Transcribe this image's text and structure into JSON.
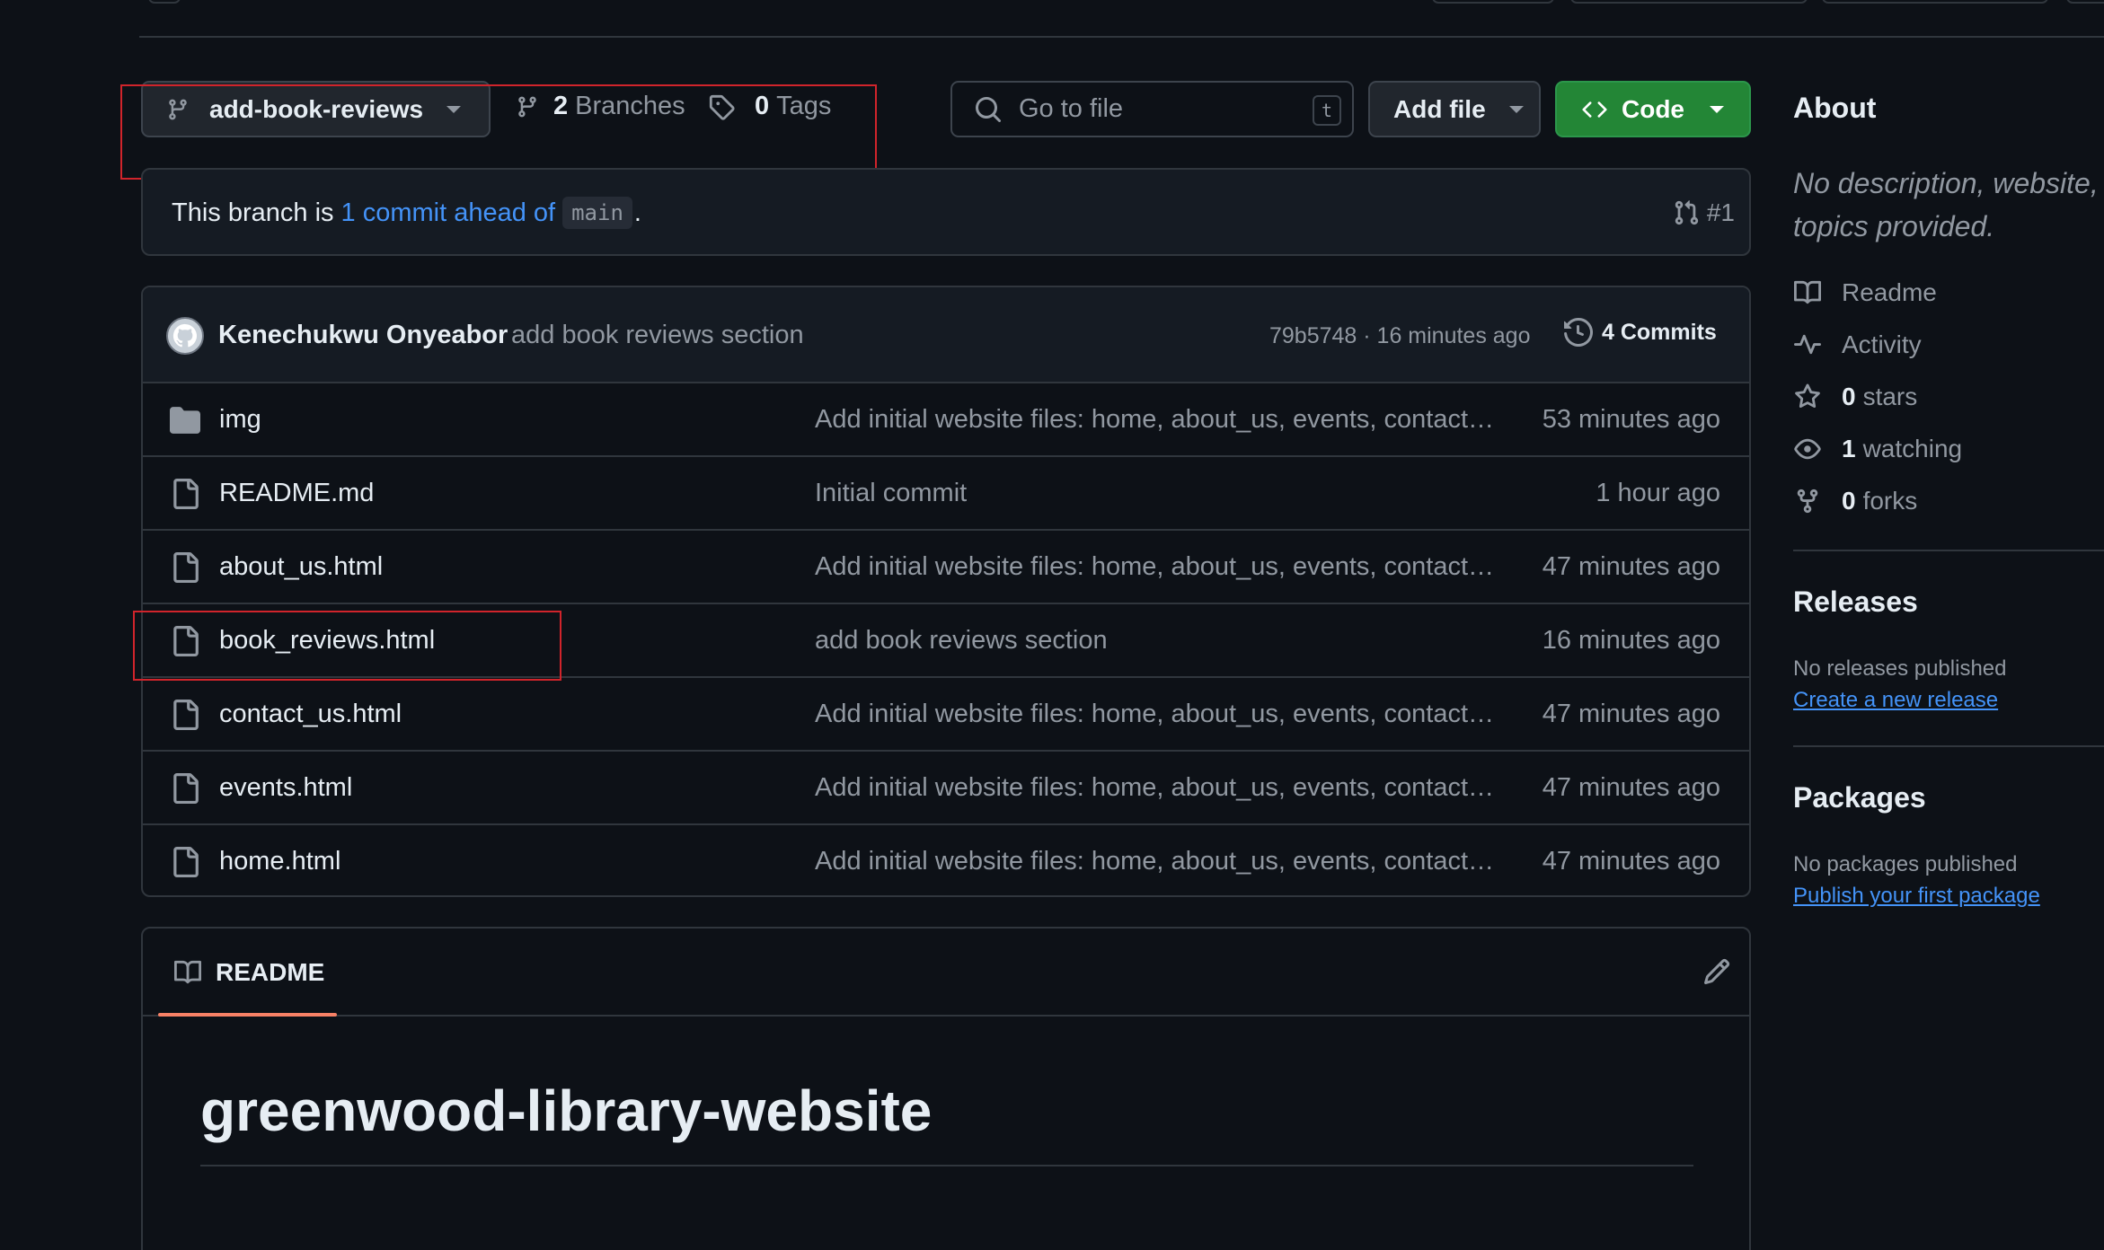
{
  "branch": {
    "name": "add-book-reviews"
  },
  "branches": {
    "count": "2",
    "label": "Branches"
  },
  "tags": {
    "count": "0",
    "label": "Tags"
  },
  "search": {
    "placeholder": "Go to file",
    "shortcut": "t"
  },
  "toolbar": {
    "add_file": "Add file",
    "code": "Code"
  },
  "compare": {
    "prefix": "This branch is",
    "link": "1 commit ahead of",
    "base": "main",
    "suffix": ".",
    "pr": "#1"
  },
  "latest_commit": {
    "author": "Kenechukwu Onyeabor",
    "message": "add book reviews section",
    "hash_time": "79b5748 · 16 minutes ago",
    "commits_count": "4 Commits"
  },
  "files": [
    {
      "name": "img",
      "type": "folder",
      "message": "Add initial website files: home, about_us, events, contact…",
      "time": "53 minutes ago"
    },
    {
      "name": "README.md",
      "type": "file",
      "message": "Initial commit",
      "time": "1 hour ago"
    },
    {
      "name": "about_us.html",
      "type": "file",
      "message": "Add initial website files: home, about_us, events, contact…",
      "time": "47 minutes ago"
    },
    {
      "name": "book_reviews.html",
      "type": "file",
      "message": "add book reviews section",
      "time": "16 minutes ago"
    },
    {
      "name": "contact_us.html",
      "type": "file",
      "message": "Add initial website files: home, about_us, events, contact…",
      "time": "47 minutes ago"
    },
    {
      "name": "events.html",
      "type": "file",
      "message": "Add initial website files: home, about_us, events, contact…",
      "time": "47 minutes ago"
    },
    {
      "name": "home.html",
      "type": "file",
      "message": "Add initial website files: home, about_us, events, contact…",
      "time": "47 minutes ago"
    }
  ],
  "readme": {
    "tab": "README",
    "heading": "greenwood-library-website"
  },
  "about": {
    "title": "About",
    "description": "No description, website, or topics provided.",
    "readme": "Readme",
    "activity": "Activity",
    "stars_count": "0",
    "stars_label": "stars",
    "watching_count": "1",
    "watching_label": "watching",
    "forks_count": "0",
    "forks_label": "forks"
  },
  "releases": {
    "title": "Releases",
    "empty": "No releases published",
    "link": "Create a new release"
  },
  "packages": {
    "title": "Packages",
    "empty": "No packages published",
    "link": "Publish your first package"
  },
  "colors": {
    "background": "#0d1117",
    "code_button": "#238636",
    "link": "#4493f8",
    "readme_underline": "#f78166",
    "annotation": "#d0242b"
  }
}
